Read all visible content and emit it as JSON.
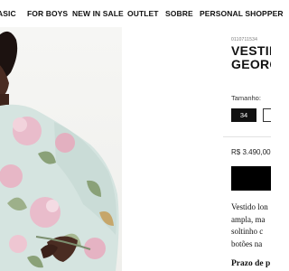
{
  "nav": {
    "items": [
      {
        "label": "ASIC"
      },
      {
        "label": "FOR BOYS"
      },
      {
        "label": "NEW IN SALE"
      },
      {
        "label": "OUTLET"
      },
      {
        "label": "SOBRE"
      },
      {
        "label": "PERSONAL SHOPPER"
      }
    ]
  },
  "product": {
    "sku": "0110711534",
    "title_line1": "VESTIDO",
    "title_line2": "GEORG",
    "size_label": "Tamanho:",
    "sizes": [
      {
        "label": "34",
        "selected": true
      },
      {
        "label": "",
        "selected": false
      }
    ],
    "price": "R$ 3.490,00",
    "description_lines": [
      "Vestido lon",
      "ampla, ma",
      "soltinho c",
      "botões na"
    ],
    "prazo": "Prazo de p"
  },
  "image": {
    "alt_subject": "model-wearing-floral-dress",
    "colors": {
      "dress_base": "#cfe0dc",
      "floral_pink": "#e7b7c6",
      "leaves": "#8aa178",
      "skin": "#4a2c22"
    }
  }
}
